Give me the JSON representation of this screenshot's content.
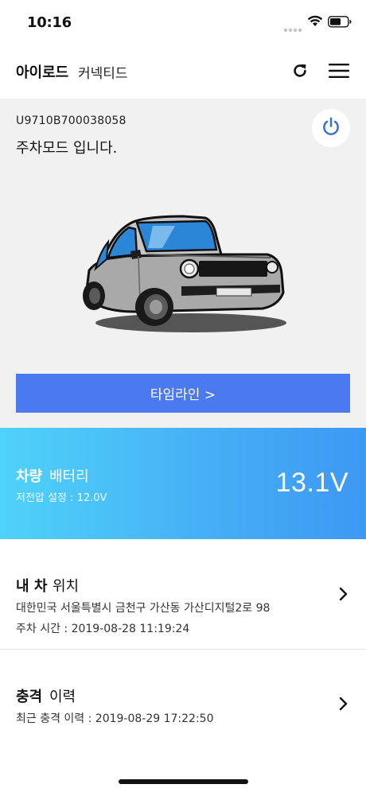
{
  "status": {
    "time": "10:16",
    "signal_icon": "cellular-dots-icon",
    "wifi_icon": "wifi-icon",
    "battery_icon": "battery-icon"
  },
  "header": {
    "brand_bold": "아이로드",
    "brand_light": "커넥티드",
    "refresh_icon": "refresh-icon",
    "menu_icon": "hamburger-menu-icon"
  },
  "vehicle": {
    "device_id": "U9710B700038058",
    "mode": "주차모드 입니다.",
    "power_icon": "power-icon",
    "timeline_label": "타임라인 >"
  },
  "battery": {
    "title_bold": "차량",
    "title_light": "배터리",
    "low_voltage_setting": "저전압 설정 : 12.0V",
    "voltage": "13.1V"
  },
  "location": {
    "title_bold": "내 차",
    "title_light": "위치",
    "address": "대한민국 서울특별시 금천구 가산동 가산디지털2로 98",
    "parking_time": "주차 시간 : 2019-08-28 11:19:24"
  },
  "impact": {
    "title_bold": "충격",
    "title_light": "이력",
    "recent": "최근 충격 이력 : 2019-08-29 17:22:50"
  },
  "colors": {
    "accent_blue": "#4b79f0",
    "power_blue": "#3a6fd8",
    "battery_gradient_start": "#4fd2f9",
    "battery_gradient_end": "#3d98f2"
  }
}
